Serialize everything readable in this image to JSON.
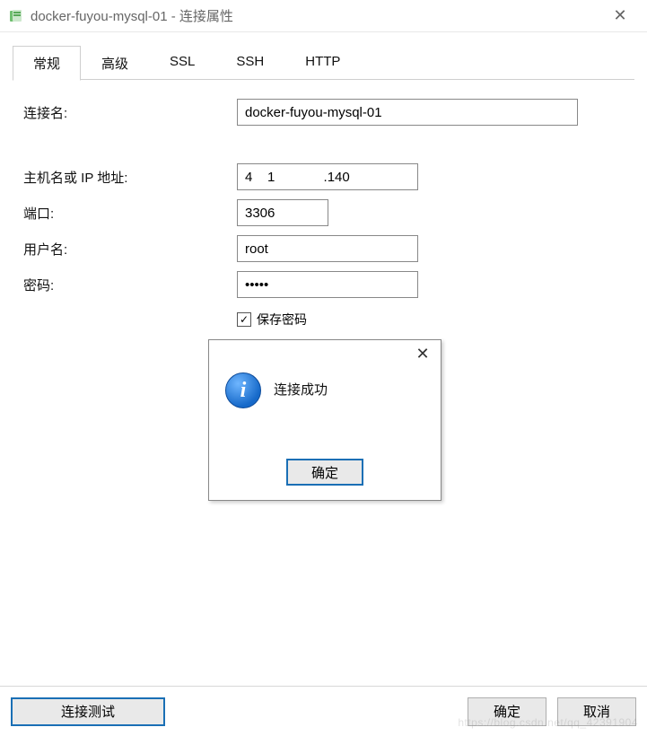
{
  "window": {
    "title": "docker-fuyou-mysql-01 - 连接属性"
  },
  "tabs": {
    "items": [
      {
        "label": "常规",
        "active": true
      },
      {
        "label": "高级",
        "active": false
      },
      {
        "label": "SSL",
        "active": false
      },
      {
        "label": "SSH",
        "active": false
      },
      {
        "label": "HTTP",
        "active": false
      }
    ]
  },
  "form": {
    "conn_name_label": "连接名:",
    "conn_name_value": "docker-fuyou-mysql-01",
    "host_label": "主机名或 IP 地址:",
    "host_value": "4    1             .140",
    "port_label": "端口:",
    "port_value": "3306",
    "user_label": "用户名:",
    "user_value": "root",
    "password_label": "密码:",
    "password_value": "•••••",
    "save_pw_label": "保存密码",
    "save_pw_checked": true
  },
  "modal": {
    "message": "连接成功",
    "ok": "确定"
  },
  "footer": {
    "test": "连接测试",
    "ok": "确定",
    "cancel": "取消"
  },
  "watermark": "https://blog.csdn.net/qq_42391904"
}
